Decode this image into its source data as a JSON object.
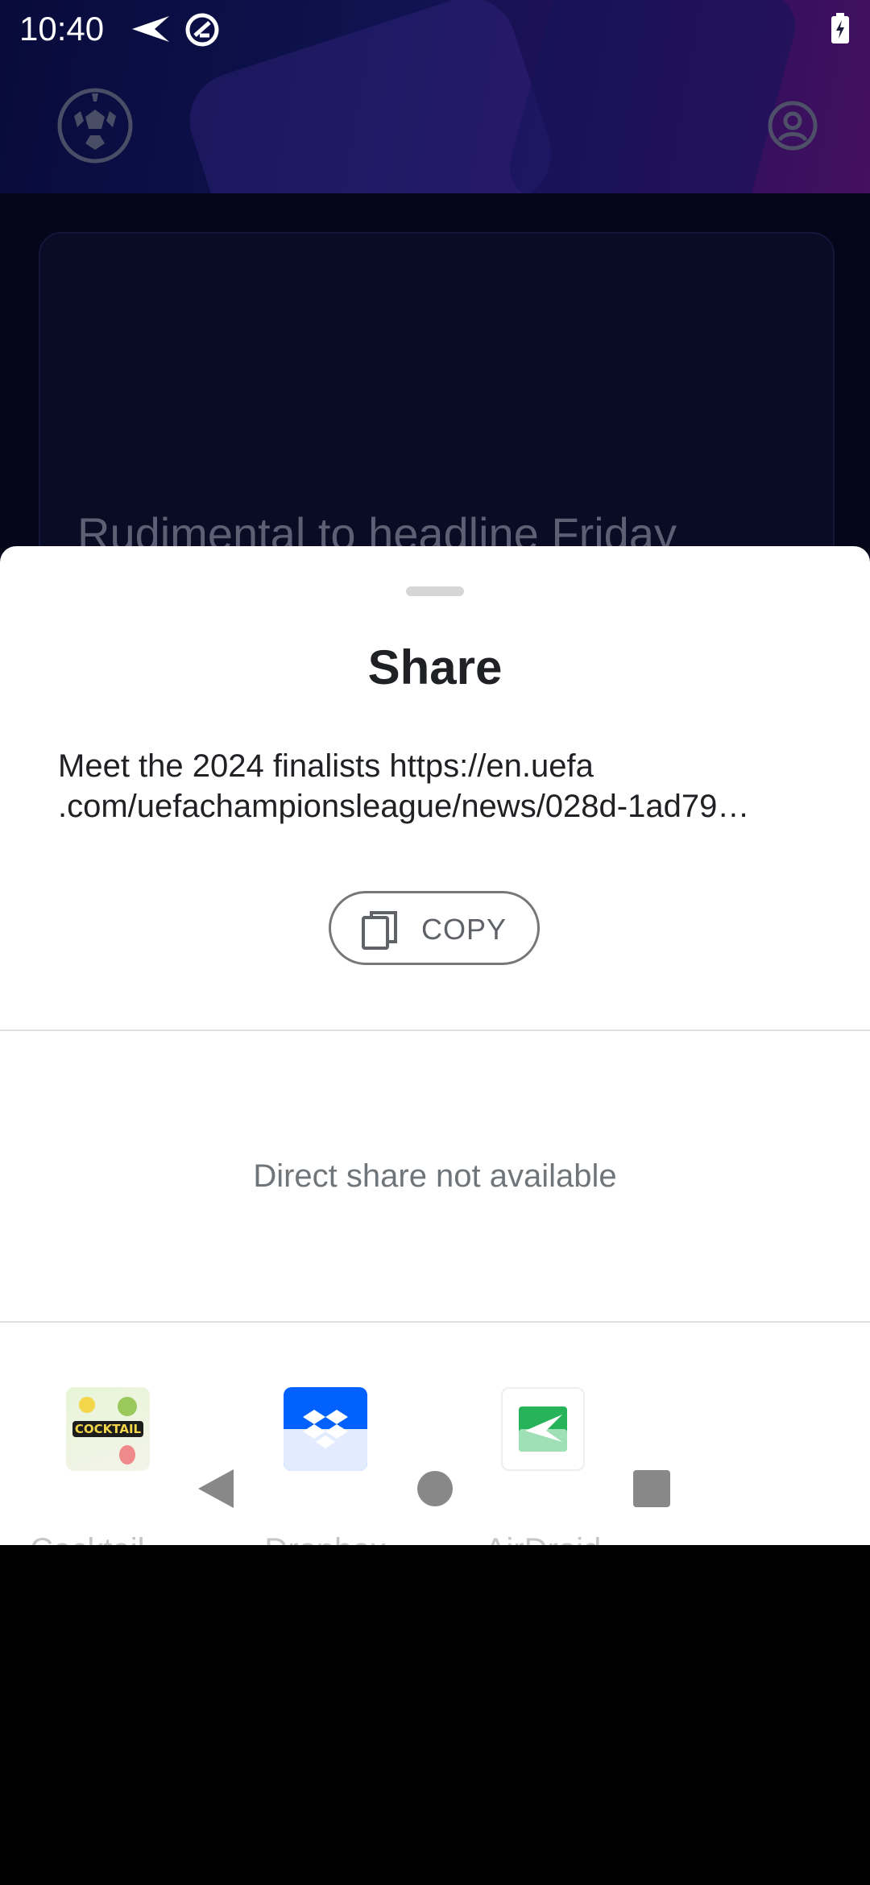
{
  "status_bar": {
    "time": "10:40"
  },
  "background_app": {
    "headline": "Rudimental to headline Friday"
  },
  "share_sheet": {
    "title": "Share",
    "shared_text_line1": "Meet the 2024 finalists https://en.uefa",
    "shared_text_line2": ".com/uefachampionsleague/news/028d-1ad79…",
    "copy_label": "COPY",
    "direct_share_message": "Direct share not available",
    "apps": [
      {
        "label": "Cocktail …",
        "icon": "cocktail-recipes-icon"
      },
      {
        "label": "Dropbox",
        "icon": "dropbox-icon"
      },
      {
        "label": "AirDroid",
        "icon": "airdroid-icon"
      }
    ]
  },
  "colors": {
    "sheet_background": "#ffffff",
    "dropbox_blue": "#0061fe",
    "airdroid_green": "#27b35a",
    "header_gradient_start": "#080b3a",
    "header_gradient_end": "#44105f"
  }
}
